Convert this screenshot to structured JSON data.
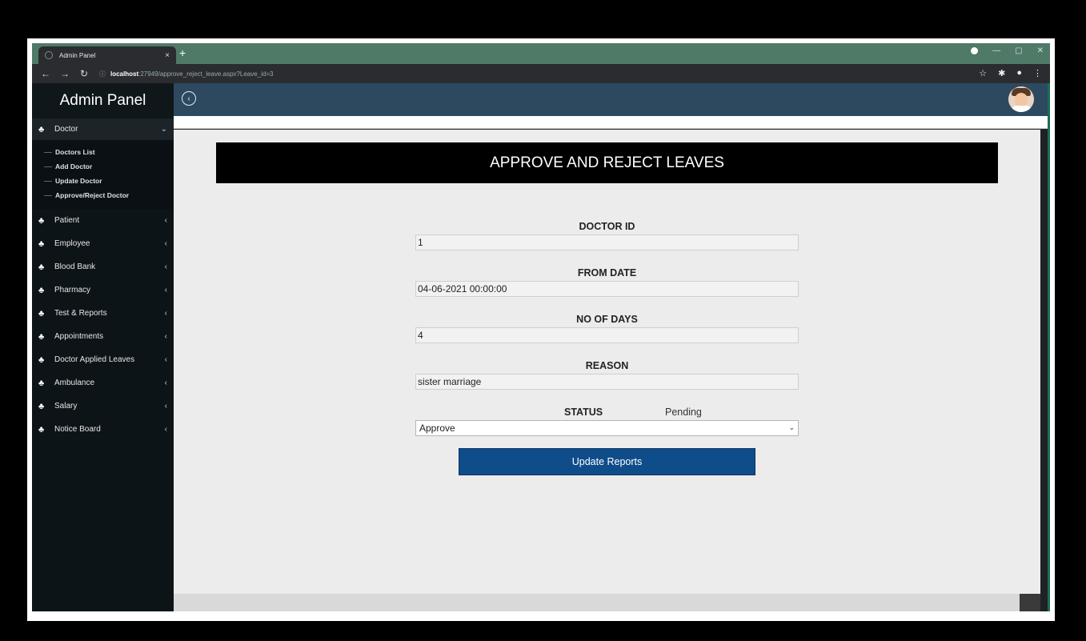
{
  "browser": {
    "tab_title": "Admin Panel",
    "tab_close": "×",
    "new_tab": "+",
    "url_host": "localhost",
    "url_rest": ":27949/approve_reject_leave.aspx?Leave_id=3"
  },
  "sidebar": {
    "brand": "Admin Panel",
    "active_item": "Doctor",
    "subitems": [
      "Doctors List",
      "Add Doctor",
      "Update Doctor",
      "Approve/Reject Doctor"
    ],
    "items": [
      "Patient",
      "Employee",
      "Blood Bank",
      "Pharmacy",
      "Test & Reports",
      "Appointments",
      "Doctor Applied Leaves",
      "Ambulance",
      "Salary",
      "Notice Board"
    ]
  },
  "main": {
    "banner_title": "APPROVE AND REJECT LEAVES",
    "fields": [
      {
        "label": "DOCTOR ID",
        "value": "1"
      },
      {
        "label": "FROM DATE",
        "value": "04-06-2021 00:00:00"
      },
      {
        "label": "NO OF DAYS",
        "value": "4"
      },
      {
        "label": "REASON",
        "value": "sister marriage"
      }
    ],
    "status_label": "STATUS",
    "status_value": "Pending",
    "status_select": "Approve",
    "submit_label": "Update Reports"
  },
  "icons": {
    "menu_icon": "users-icon",
    "back": "circle-chevron-left-icon",
    "avatar": "user-avatar"
  }
}
